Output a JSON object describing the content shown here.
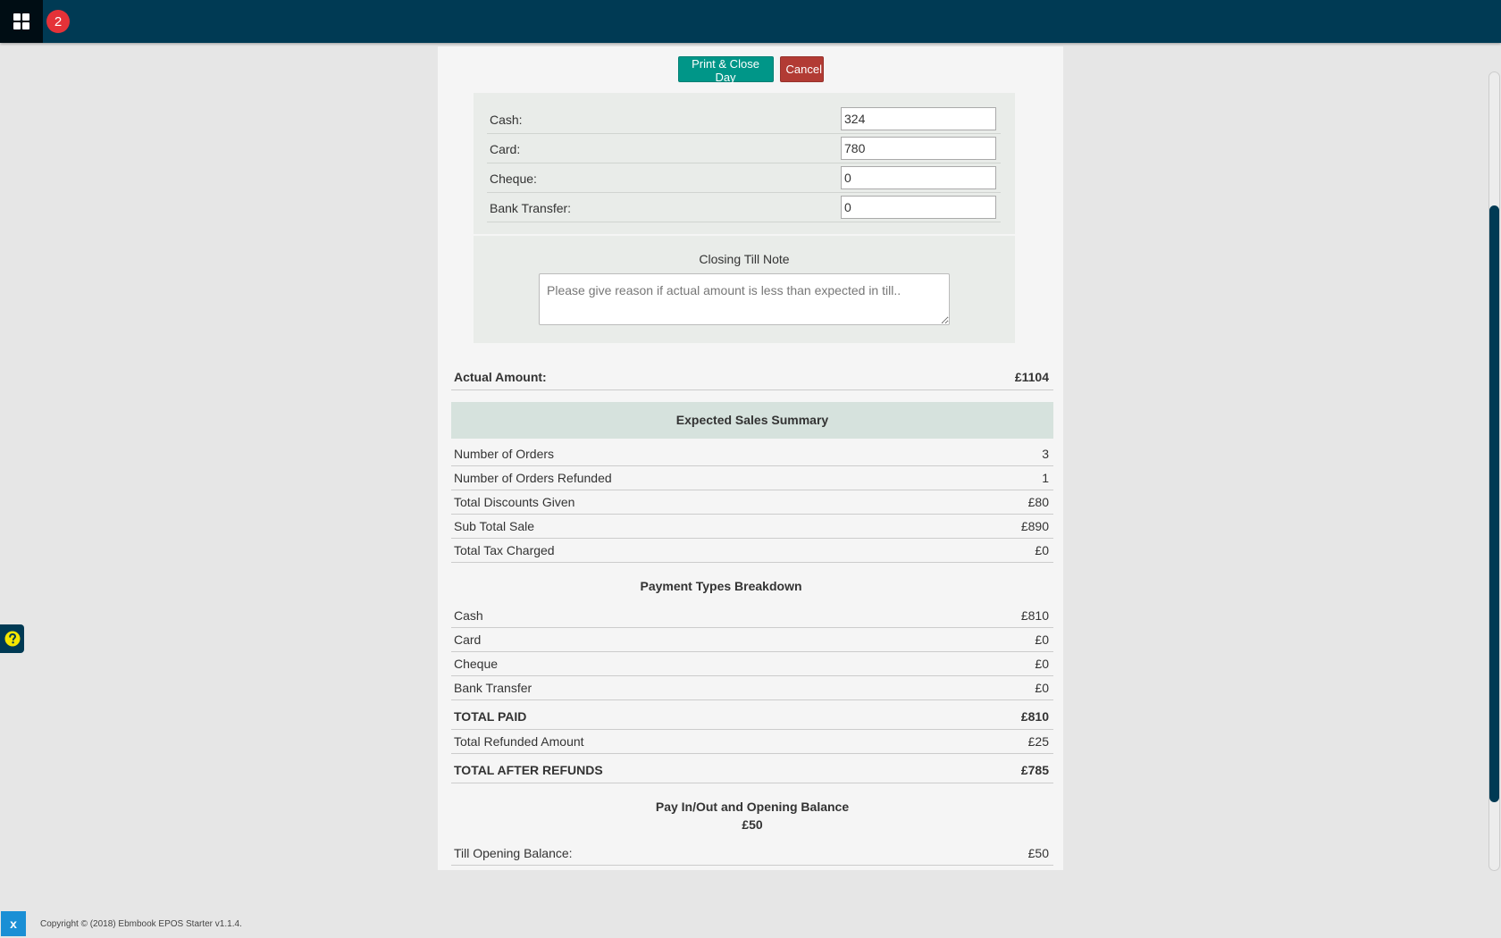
{
  "topbar": {
    "apps_icon": "apps-grid-icon",
    "notification_count": "2"
  },
  "actions": {
    "print_close_label": "Print & Close Day",
    "cancel_label": "Cancel"
  },
  "amounts": [
    {
      "label": "Cash:",
      "value": "324"
    },
    {
      "label": "Card:",
      "value": "780"
    },
    {
      "label": "Cheque:",
      "value": "0"
    },
    {
      "label": "Bank Transfer:",
      "value": "0"
    }
  ],
  "note": {
    "title": "Closing Till Note",
    "placeholder": "Please give reason if actual amount is less than expected in till.."
  },
  "actual_amount": {
    "label": "Actual Amount:",
    "value": "£1104"
  },
  "expected_summary": {
    "title": "Expected Sales Summary",
    "rows": [
      {
        "label": "Number of Orders",
        "value": "3"
      },
      {
        "label": "Number of Orders Refunded",
        "value": "1"
      },
      {
        "label": "Total Discounts Given",
        "value": "£80"
      },
      {
        "label": "Sub Total Sale",
        "value": "£890"
      },
      {
        "label": "Total Tax Charged",
        "value": "£0"
      }
    ]
  },
  "payment_breakdown": {
    "title": "Payment Types Breakdown",
    "rows": [
      {
        "label": "Cash",
        "value": "£810"
      },
      {
        "label": "Card",
        "value": "£0"
      },
      {
        "label": "Cheque",
        "value": "£0"
      },
      {
        "label": "Bank Transfer",
        "value": "£0"
      }
    ],
    "total_paid": {
      "label": "TOTAL PAID",
      "value": "£810"
    },
    "refunded": {
      "label": "Total Refunded Amount",
      "value": "£25"
    },
    "total_after_refunds": {
      "label": "TOTAL AFTER REFUNDS",
      "value": "£785"
    }
  },
  "pay_in_out": {
    "title": "Pay In/Out and Opening Balance",
    "amount": "£50",
    "opening_balance": {
      "label": "Till Opening Balance:",
      "value": "£50"
    }
  },
  "help_icon": "help-question-icon",
  "close_label": "x",
  "footer": {
    "copyright": "Copyright © (2018) Ebmbook EPOS Starter v1.1.4."
  }
}
